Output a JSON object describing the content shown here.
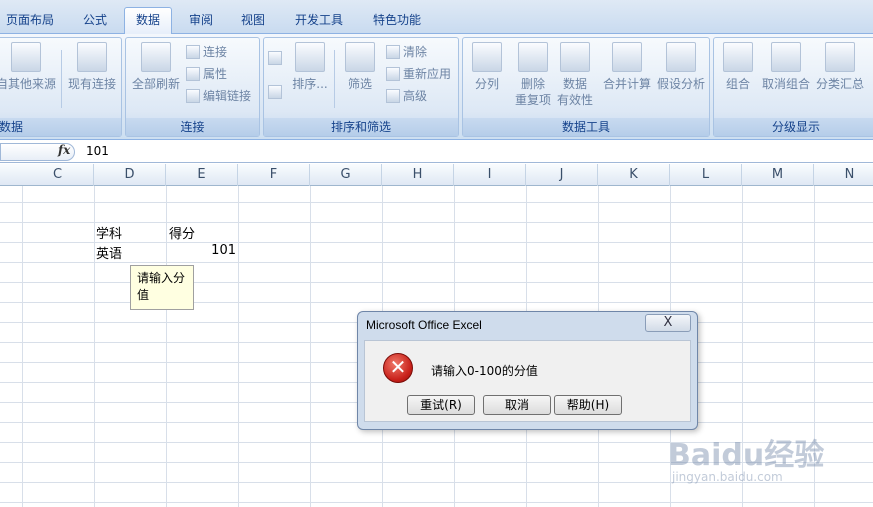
{
  "ribbon": {
    "tabs": [
      {
        "label": "页面布局",
        "active": false
      },
      {
        "label": "公式",
        "active": false
      },
      {
        "label": "数据",
        "active": true
      },
      {
        "label": "审阅",
        "active": false
      },
      {
        "label": "视图",
        "active": false
      },
      {
        "label": "开发工具",
        "active": false
      },
      {
        "label": "特色功能",
        "active": false
      }
    ],
    "groups": {
      "get_external": {
        "label": "数据",
        "button": "自其他来源"
      },
      "existing": {
        "button": "现有连接"
      },
      "connections": {
        "label": "连接",
        "refresh": "全部刷新",
        "connections": "连接",
        "properties": "属性",
        "edit_links": "编辑链接"
      },
      "sort_filter": {
        "label": "排序和筛选",
        "sort": "排序...",
        "filter": "筛选",
        "clear": "清除",
        "reapply": "重新应用",
        "advanced": "高级"
      },
      "data_tools": {
        "label": "数据工具",
        "text_to_cols": "分列",
        "remove_dup_1": "删除",
        "remove_dup_2": "重复项",
        "validation_1": "数据",
        "validation_2": "有效性",
        "consolidate": "合并计算",
        "what_if": "假设分析"
      },
      "outline": {
        "label": "分级显示",
        "group": "组合",
        "ungroup": "取消组合",
        "subtotal": "分类汇总"
      }
    }
  },
  "formula_bar": {
    "fx": "fx",
    "value": "101"
  },
  "columns": [
    "C",
    "D",
    "E",
    "F",
    "G",
    "H",
    "I",
    "J",
    "K",
    "L",
    "M",
    "N"
  ],
  "cells": {
    "d_header": "学科",
    "e_header": "得分",
    "d_value": "英语",
    "e_value": "101"
  },
  "tooltip": {
    "line1": "请输入分",
    "line2": "值"
  },
  "dialog": {
    "title": "Microsoft Office Excel",
    "close": "X",
    "message": "请输入0-100的分值",
    "buttons": {
      "retry": "重试(R)",
      "cancel": "取消",
      "help": "帮助(H)"
    }
  },
  "watermark": {
    "logo": "Baidu经验",
    "url": "jingyan.baidu.com"
  }
}
